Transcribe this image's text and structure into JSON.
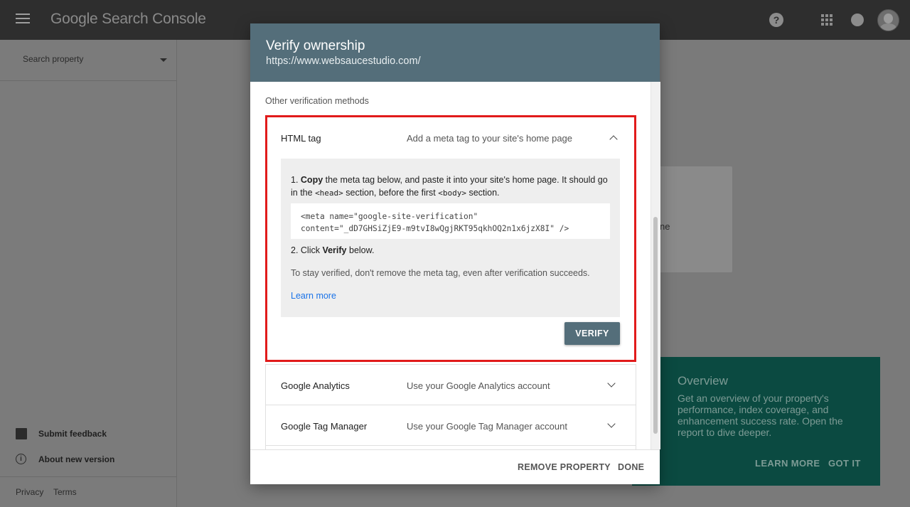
{
  "app": {
    "logo": "Google Search Console"
  },
  "header": {
    "help_glyph": "?"
  },
  "sidebar": {
    "search_placeholder": "Search property",
    "submit_feedback": "Submit feedback",
    "about": "About new version",
    "about_glyph": "i",
    "privacy": "Privacy",
    "terms": "Terms"
  },
  "background": {
    "card_fragment": "ne"
  },
  "overview": {
    "title": "Overview",
    "text": "Get an overview of your property's performance, index coverage, and enhancement success rate. Open the report to dive deeper.",
    "learn_more": "LEARN MORE",
    "got_it": "GOT IT"
  },
  "dialog": {
    "title": "Verify ownership",
    "url": "https://www.websaucestudio.com/",
    "other_methods": "Other verification methods",
    "html_tag": {
      "name": "HTML tag",
      "desc": "Add a meta tag to your site's home page",
      "step1_num": "1. ",
      "step1_bold": "Copy",
      "step1_a": " the meta tag below, and paste it into your site's home page. It should go in the ",
      "step1_head": "<head>",
      "step1_b": " section, before the first ",
      "step1_body": "<body>",
      "step1_c": " section.",
      "meta_line1": "<meta name=\"google-site-verification\"",
      "meta_line2": "content=\"_dD7GHSiZjE9-m9tvI8wQgjRKT95qkhOQ2n1x6jzX8I\" />",
      "step2_a": "2. Click ",
      "step2_bold": "Verify",
      "step2_b": " below.",
      "stay": "To stay verified, don't remove the meta tag, even after verification succeeds.",
      "learn_more": "Learn more",
      "verify": "VERIFY"
    },
    "methods": [
      {
        "name": "Google Analytics",
        "desc": "Use your Google Analytics account"
      },
      {
        "name": "Google Tag Manager",
        "desc": "Use your Google Tag Manager account"
      }
    ],
    "remove_property": "REMOVE PROPERTY",
    "done": "DONE"
  },
  "colors": {
    "dialog_header": "#546e7a",
    "highlight": "#e11b1b",
    "overview_bg": "#0b4a41",
    "link": "#1a73e8"
  }
}
